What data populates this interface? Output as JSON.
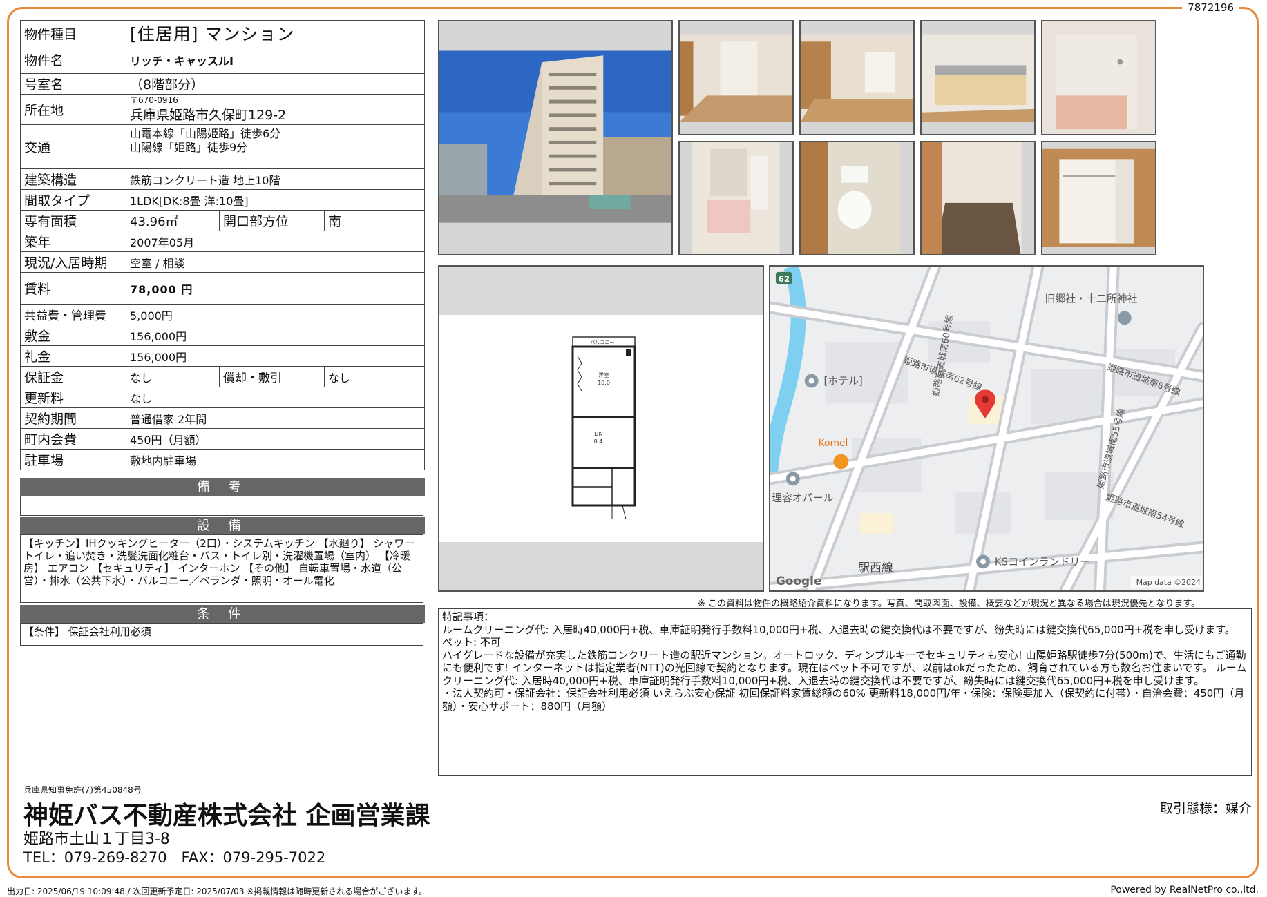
{
  "doc_id": "7872196",
  "property": {
    "type_label": "物件種目",
    "type_value": "[住居用]  マンション",
    "name_label": "物件名",
    "name_value": "リッチ・キャッスルⅠ",
    "room_label": "号室名",
    "room_value": "（8階部分）",
    "location_label": "所在地",
    "zip": "〒670-0916",
    "address": "兵庫県姫路市久保町129-2",
    "transit_label": "交通",
    "transit_1": "山電本線「山陽姫路」徒歩6分",
    "transit_2": "山陽線「姫路」徒歩9分",
    "structure_label": "建築構造",
    "structure_value": "鉄筋コンクリート造 地上10階",
    "layout_label": "間取タイプ",
    "layout_value": "1LDK[DK:8畳 洋:10畳]",
    "area_label": "専有面積",
    "area_value": "43.96㎡",
    "direction_label": "開口部方位",
    "direction_value": "南",
    "built_label": "築年",
    "built_value": "2007年05月",
    "status_label": "現況/入居時期",
    "status_value": "空室 / 相談",
    "rent_label": "賃料",
    "rent_value": "78,000 円",
    "fee_label": "共益費・管理費",
    "fee_value": "5,000円",
    "deposit_label": "敷金",
    "deposit_value": "156,000円",
    "key_money_label": "礼金",
    "key_money_value": "156,000円",
    "guarantee_label": "保証金",
    "guarantee_value": "なし",
    "amort_label": "償却・敷引",
    "amort_value": "なし",
    "renewal_label": "更新料",
    "renewal_value": "なし",
    "contract_label": "契約期間",
    "contract_value": "普通借家 2年間",
    "town_fee_label": "町内会費",
    "town_fee_value": "450円（月額）",
    "parking_label": "駐車場",
    "parking_value": "敷地内駐車場"
  },
  "sections": {
    "notes_title": "備 考",
    "equipment_title": "設 備",
    "equipment_text": "【キッチン】IHクッキングヒーター（2口）・システムキッチン 【水廻り】 シャワートイレ・追い焚き・洗髪洗面化粧台・バス・トイレ別・洗濯機置場（室内） 【冷暖房】 エアコン 【セキュリティ】 インターホン 【その他】 自転車置場・水道（公営）・排水（公共下水）・バルコニー／ベランダ・照明・オール電化",
    "conditions_title": "条 件",
    "conditions_text": "【条件】 保証会社利用必須"
  },
  "floorplan": {
    "room1_label": "洋室",
    "room1_size": "10.0",
    "room2_label": "DK",
    "room2_size": "8.4",
    "balcony": "バルコニー"
  },
  "map": {
    "route_badge": "62",
    "shrine": "旧郷社・十二所神社",
    "hotel": "[ホテル]",
    "restaurant": "Komel",
    "barber": "理容オパール",
    "laundry": "KSコインランドリー",
    "station_road": "駅西線",
    "road_1": "姫路市道城南60号線",
    "road_2": "姫路市道城南62号線",
    "road_3": "姫路市道城南8号線",
    "road_4": "姫路市道城南55号線",
    "road_5": "姫路市道城南54号線",
    "google": "Google",
    "credit": "Map data ©2024"
  },
  "disclaimer": "※ この資料は物件の概略紹介資料になります。写真、間取図面、設備、概要などが現況と異なる場合は現況優先となります。",
  "remarks": {
    "line1": "特記事項：",
    "line2": "ルームクリーニング代: 入居時40,000円+税、車庫証明発行手数料10,000円+税、入退去時の鍵交換代は不要ですが、紛失時には鍵交換代65,000円+税を申し受けます。",
    "line3": "ペット: 不可",
    "line4": "ハイグレードな設備が充実した鉄筋コンクリート造の駅近マンション。オートロック、ディンプルキーでセキュリティも安心! 山陽姫路駅徒歩7分(500m)で、生活にもご通勤にも便利です! インターネットは指定業者(NTT)の光回線で契約となります。現在はペット不可ですが、以前はokだったため、飼育されている方も数名お住まいです。 ルームクリーニング代: 入居時40,000円+税、車庫証明発行手数料10,000円+税、入退去時の鍵交換代は不要ですが、紛失時には鍵交換代65,000円+税を申し受けます。",
    "line5": "・法人契約可・保証会社：保証会社利用必須 いえらぶ安心保証 初回保証料家賃総額の60% 更新料18,000円/年・保険：保険要加入（保契約に付帯）・自治会費：450円（月額）・安心サポート：880円（月額）"
  },
  "company": {
    "license": "兵庫県知事免許(7)第450848号",
    "name": "神姫バス不動産株式会社 企画営業課",
    "address": "姫路市土山１丁目3-8",
    "tel": "TEL：079-269-8270　FAX：079-295-7022",
    "deal_type": "取引態様：媒介"
  },
  "footer": {
    "left": "出力日: 2025/06/19 10:09:48 / 次回更新予定日: 2025/07/03 ※掲載情報は随時更新される場合がございます。",
    "right": "Powered by RealNetPro co.,ltd."
  },
  "colors": {
    "frame": "#e88a3c",
    "section_bar": "#666666",
    "map_water": "#7fd0f0",
    "map_pin": "#e53935"
  }
}
